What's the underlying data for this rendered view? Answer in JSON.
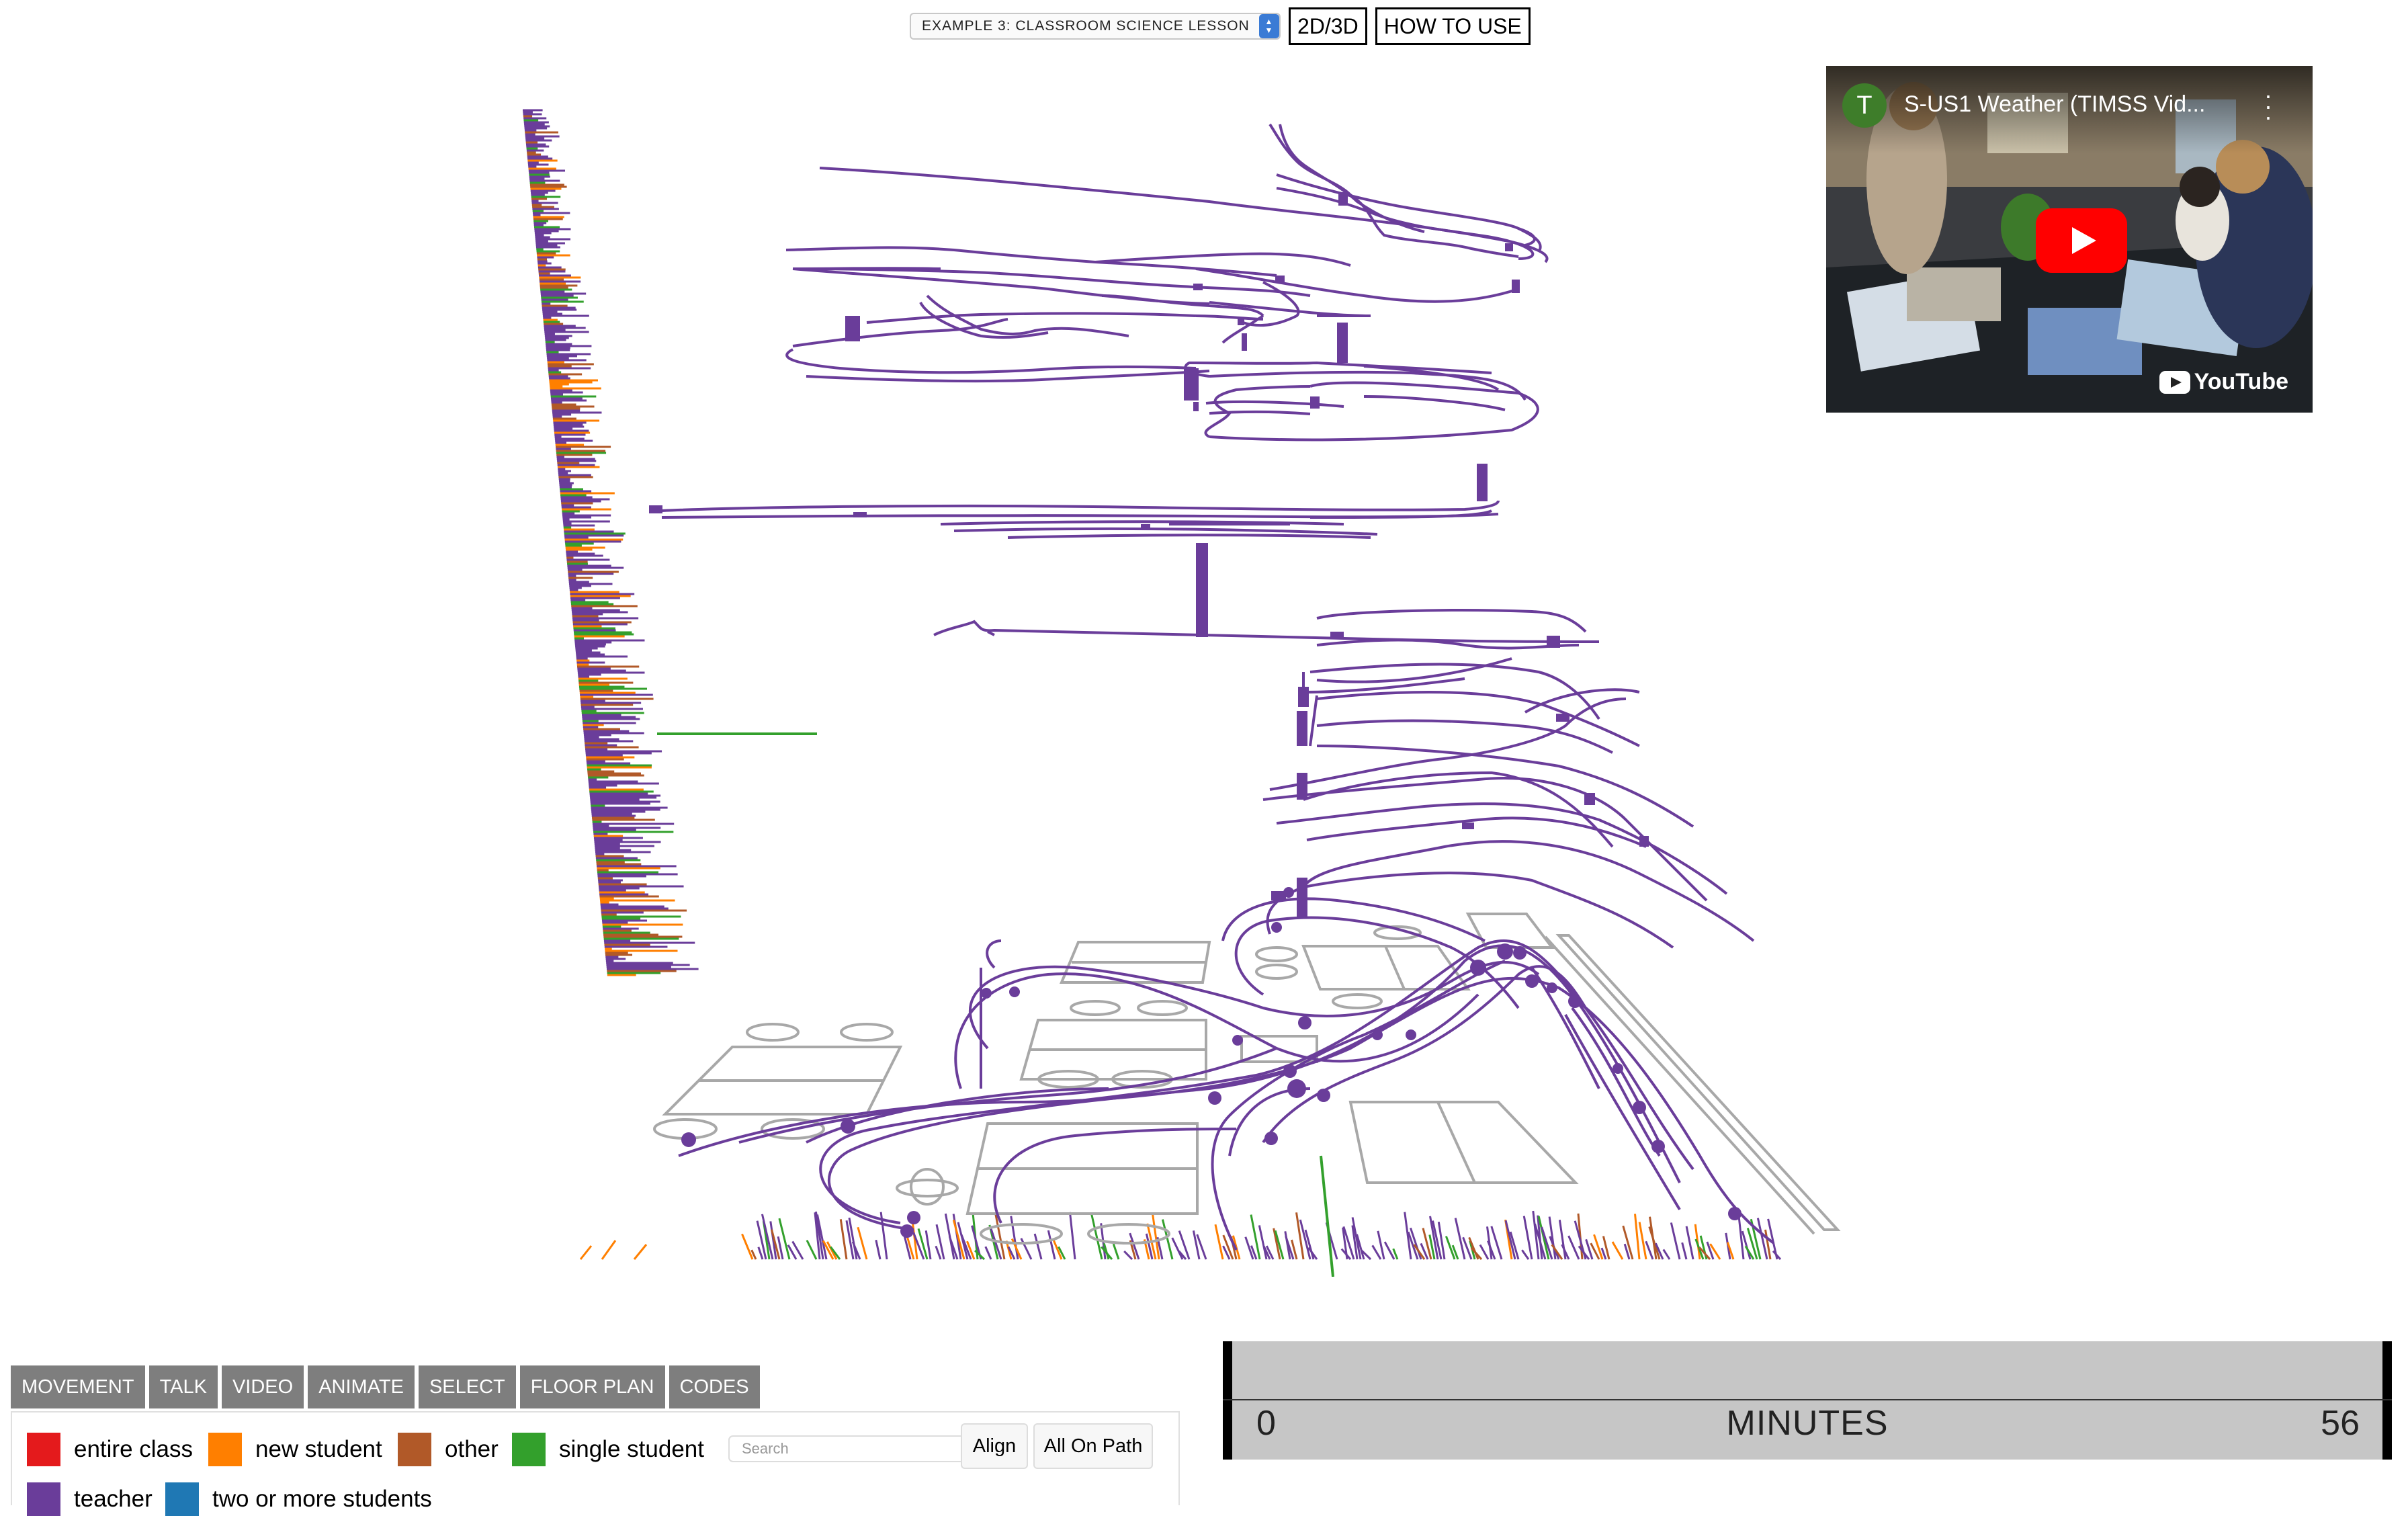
{
  "header": {
    "example_select": "EXAMPLE 3: CLASSROOM SCIENCE LESSON",
    "view_toggle_label": "2D/3D",
    "how_to_use_label": "HOW TO USE"
  },
  "video": {
    "channel_initial": "T",
    "title": "S-US1 Weather (TIMSS Vid...",
    "platform": "YouTube"
  },
  "tabs": [
    "MOVEMENT",
    "TALK",
    "VIDEO",
    "ANIMATE",
    "SELECT",
    "FLOOR PLAN",
    "CODES"
  ],
  "codes": [
    {
      "label": "entire class",
      "color": "#e41a1c"
    },
    {
      "label": "new student",
      "color": "#ff7f00"
    },
    {
      "label": "other",
      "color": "#b15928"
    },
    {
      "label": "single student",
      "color": "#33a02c"
    },
    {
      "label": "teacher",
      "color": "#6a3d9a"
    },
    {
      "label": "two or more students",
      "color": "#1f78b4"
    }
  ],
  "search": {
    "placeholder": "Search"
  },
  "buttons": {
    "align": "Align",
    "all_on_path": "All On Path"
  },
  "timeline": {
    "start": "0",
    "label": "MINUTES",
    "end": "56"
  },
  "colors": {
    "path": "#6a3d9a",
    "floorplan": "#a8a8a8",
    "tab_bg": "#7e7e7e",
    "timeline_bg": "#c6c6c6"
  }
}
